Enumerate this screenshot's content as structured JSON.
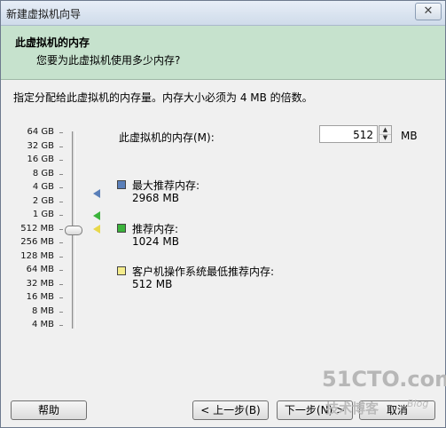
{
  "window": {
    "title": "新建虚拟机向导",
    "close_glyph": "✕"
  },
  "header": {
    "title": "此虚拟机的内存",
    "subtitle": "您要为此虚拟机使用多少内存?"
  },
  "instruction": "指定分配给此虚拟机的内存量。内存大小必须为 4 MB 的倍数。",
  "scale_labels": [
    "64 GB",
    "32 GB",
    "16 GB",
    "8 GB",
    "4 GB",
    "2 GB",
    "1 GB",
    "512 MB",
    "256 MB",
    "128 MB",
    "64 MB",
    "32 MB",
    "16 MB",
    "8 MB",
    "4 MB"
  ],
  "memory": {
    "label": "此虚拟机的内存(M):",
    "value": "512",
    "unit": "MB",
    "spin_up": "▲",
    "spin_down": "▼"
  },
  "legend": {
    "max_recommended": {
      "title": "最大推荐内存:",
      "value": "2968 MB",
      "color": "#5a7fb9"
    },
    "recommended": {
      "title": "推荐内存:",
      "value": "1024 MB",
      "color": "#3bb33b"
    },
    "guest_min": {
      "title": "客户机操作系统最低推荐内存:",
      "value": "512 MB",
      "color": "#e8d84a"
    }
  },
  "buttons": {
    "help": "帮助",
    "back": "< 上一步(B)",
    "next": "下一步(N) >",
    "cancel": "取消"
  },
  "watermark": {
    "main": "51CTO.com",
    "sub": "技术博客",
    "blog": "Blog"
  }
}
